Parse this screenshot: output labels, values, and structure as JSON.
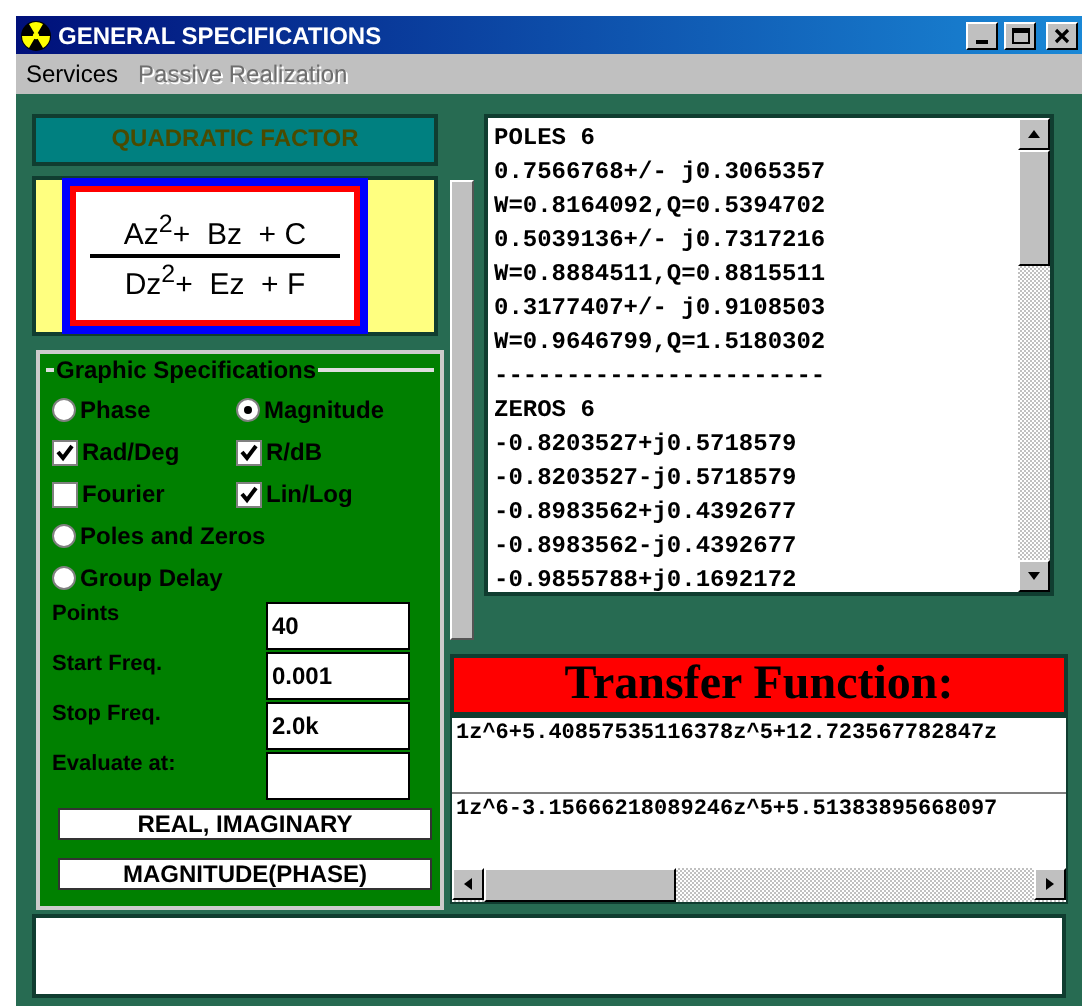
{
  "window": {
    "title": "GENERAL SPECIFICATIONS"
  },
  "menu": [
    {
      "label": "Services",
      "disabled": false
    },
    {
      "label": "Passive Realization",
      "disabled": true
    }
  ],
  "quadratic_factor_button": "QUADRATIC FACTOR",
  "formula": {
    "numerator": "Az$^{2}$+  Bz  + C",
    "denominator": "Dz$^{2}$+  Ez  + F"
  },
  "graphic_specifications": {
    "title": "Graphic Specifications",
    "options": [
      {
        "kind": "radio",
        "label": "Phase",
        "selected": false
      },
      {
        "kind": "radio",
        "label": "Magnitude",
        "selected": true
      },
      {
        "kind": "checkbox",
        "label": "Rad/Deg",
        "checked": true
      },
      {
        "kind": "checkbox",
        "label": "R/dB",
        "checked": true
      },
      {
        "kind": "checkbox",
        "label": "Fourier",
        "checked": false
      },
      {
        "kind": "checkbox",
        "label": "Lin/Log",
        "checked": true
      }
    ],
    "more_options": [
      {
        "kind": "radio",
        "label": "Poles and Zeros",
        "selected": false
      },
      {
        "kind": "radio",
        "label": "Group Delay",
        "selected": false
      }
    ],
    "fields": [
      {
        "label": "Points",
        "value": "40"
      },
      {
        "label": "Start Freq.",
        "value": "0.001"
      },
      {
        "label": "Stop Freq.",
        "value": "2.0k"
      },
      {
        "label": "Evaluate at:"
      }
    ],
    "buttons": [
      "REAL, IMAGINARY",
      "MAGNITUDE(PHASE)"
    ]
  },
  "results": [
    "POLES 6",
    "0.7566768+/- j0.3065357",
    "W=0.8164092,Q=0.5394702",
    "0.5039136+/- j0.7317216",
    "W=0.8884511,Q=0.8815511",
    "0.3177407+/- j0.9108503",
    "W=0.9646799,Q=1.5180302",
    "-----------------------",
    "ZEROS 6",
    "-0.8203527+j0.5718579",
    "-0.8203527-j0.5718579",
    "-0.8983562+j0.4392677",
    "-0.8983562-j0.4392677",
    "-0.9855788+j0.1692172"
  ],
  "transfer_function": {
    "title": "Transfer Function:",
    "numerator": "1z^6+5.40857535116378z^5+12.723567782847z",
    "denominator": "1z^6-3.15666218089246z^5+5.51383895668097"
  }
}
